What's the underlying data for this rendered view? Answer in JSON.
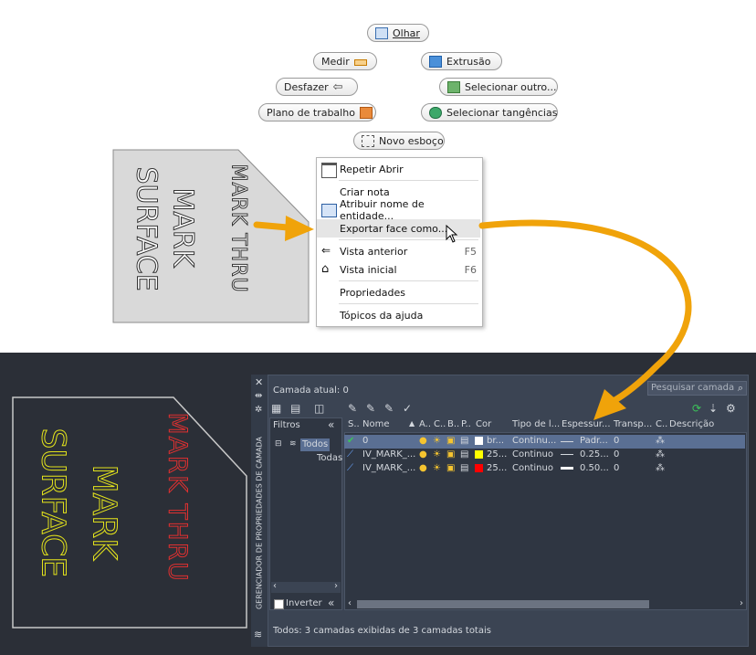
{
  "marking_menu": {
    "olhar": "Olhar",
    "medir": "Medir",
    "extrusao": "Extrusão",
    "desfazer": "Desfazer",
    "selecionar_outro": "Selecionar outro...",
    "plano_trabalho": "Plano de trabalho",
    "selecionar_tangencias": "Selecionar tangências",
    "novo_esboco": "Novo esboço"
  },
  "part_text": {
    "line1": "MARK THRU",
    "line2": "MARK",
    "line3": "SURFACE"
  },
  "context_menu": {
    "items": [
      {
        "label": "Repetir Abrir",
        "shortcut": ""
      },
      {
        "label": "Criar nota",
        "shortcut": ""
      },
      {
        "label": "Atribuir nome de entidade...",
        "shortcut": ""
      },
      {
        "label": "Exportar face como...",
        "shortcut": ""
      },
      {
        "label": "Vista anterior",
        "shortcut": "F5"
      },
      {
        "label": "Vista inicial",
        "shortcut": "F6"
      },
      {
        "label": "Propriedades",
        "shortcut": ""
      },
      {
        "label": "Tópicos da ajuda",
        "shortcut": ""
      }
    ]
  },
  "layer_manager": {
    "current_layer": "Camada atual: 0",
    "search_placeholder": "Pesquisar camada",
    "filters_title": "Filtros",
    "tree": {
      "all": "Todos",
      "all_used": "Todas"
    },
    "invert": "Inverter",
    "side_title": "GERENCIADOR DE PROPRIEDADES DE CAMADA",
    "status": "Todos: 3 camadas exibidas de 3 camadas totais",
    "columns": [
      "S..",
      "Nome",
      "A..",
      "C..",
      "B..",
      "P..",
      "Cor",
      "Tipo de l...",
      "Espessur...",
      "Transp...",
      "C..",
      "Descrição"
    ],
    "rows": [
      {
        "name": "0",
        "color_name": "br...",
        "color": "#ffffff",
        "linetype": "Continu...",
        "lineweight": "Padr...",
        "transparency": "0",
        "selected": true,
        "current": true
      },
      {
        "name": "IV_MARK_...",
        "color_name": "25...",
        "color": "#ffff00",
        "linetype": "Continuo",
        "lineweight": "0.25...",
        "transparency": "0",
        "selected": false,
        "current": false
      },
      {
        "name": "IV_MARK_...",
        "color_name": "25...",
        "color": "#ff0000",
        "linetype": "Continuo",
        "lineweight": "0.50...",
        "transparency": "0",
        "selected": false,
        "current": false
      }
    ]
  },
  "colors": {
    "accent_arrow": "#f0a30a",
    "dark_bg": "#2b2f37",
    "panel_bg": "#3b4453",
    "selected_row": "#5a6f93"
  }
}
